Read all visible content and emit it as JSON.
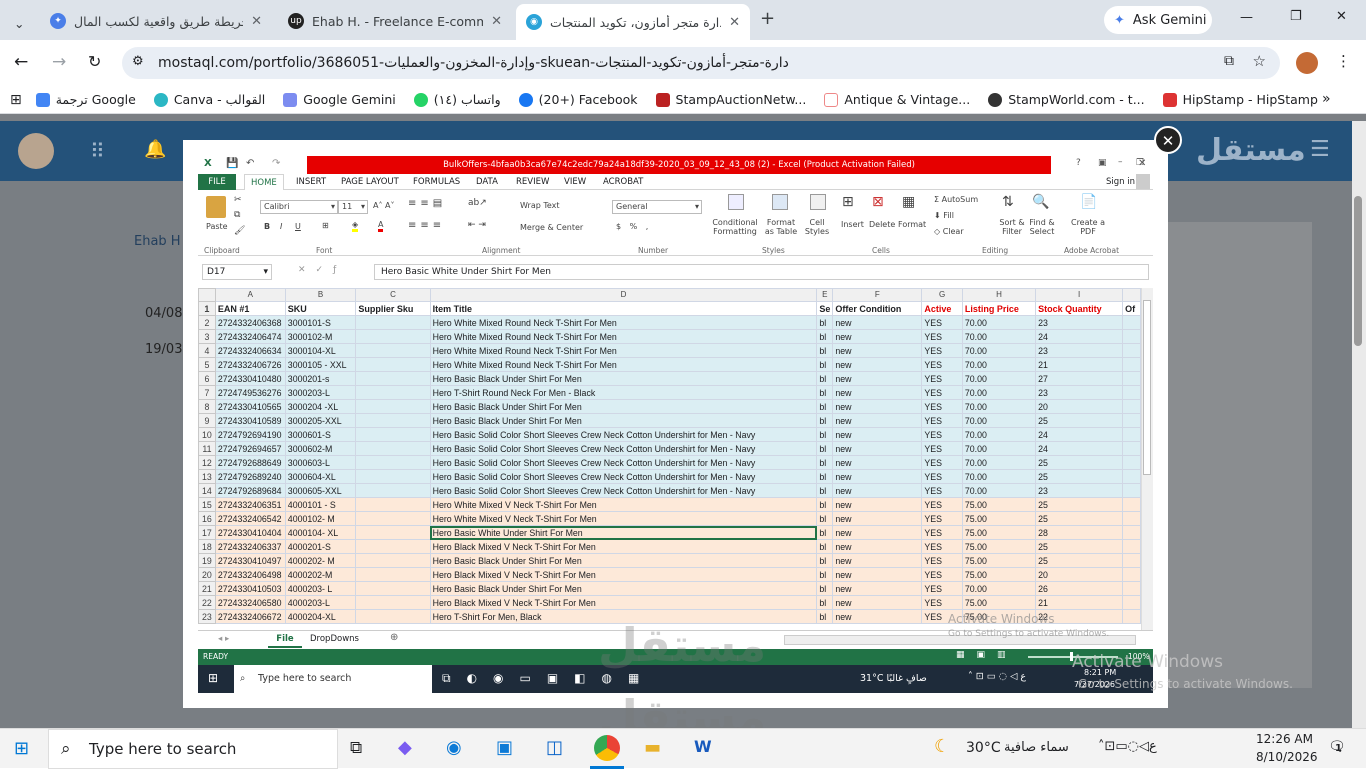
{
  "browser": {
    "tabs": [
      {
        "title": "خريطة طريق واقعية لكسب المال",
        "icon": "gemini-icon"
      },
      {
        "title": "Ehab H. - Freelance E-commerc",
        "icon": "upwork-icon"
      },
      {
        "title": "دارة متجر أمازون، تكويد المنتجات",
        "icon": "mostaql-icon"
      }
    ],
    "ask_gemini": "Ask Gemini",
    "url": "mostaql.com/portfolio/3686051-وإدارة-المخزون-والعمليات-skuean-دارة-متجر-أمازون-تكويد-المنتجات",
    "bookmarks": [
      "ترجمة Google",
      "Canva - القوالب",
      "Google Gemini",
      "(١٤) واتساب",
      "(20+) Facebook",
      "StampAuctionNetw...",
      "Antique & Vintage...",
      "StampWorld.com - t...",
      "HipStamp - HipStamp"
    ]
  },
  "site": {
    "logo": "مستقل",
    "side_name": "Ehab H",
    "dates": [
      "04/08",
      "19/03"
    ]
  },
  "excel": {
    "title": "BulkOffers-4bfaa0b3ca67e74c2edc79a24a18df39-2020_03_09_12_43_08 (2) -  Excel (Product Activation Failed)",
    "sign_in": "Sign in",
    "ribbon_tabs": [
      "FILE",
      "HOME",
      "INSERT",
      "PAGE LAYOUT",
      "FORMULAS",
      "DATA",
      "REVIEW",
      "VIEW",
      "ACROBAT"
    ],
    "font_name": "Calibri",
    "font_size": "11",
    "number_format": "General",
    "groups": [
      "Clipboard",
      "Font",
      "Alignment",
      "Number",
      "Styles",
      "Cells",
      "Editing",
      "Adobe Acrobat"
    ],
    "buttons": [
      "Paste",
      "Wrap Text",
      "Merge & Center",
      "Conditional Formatting",
      "Format as Table",
      "Cell Styles",
      "Insert",
      "Delete",
      "Format",
      "AutoSum",
      "Fill",
      "Clear",
      "Sort & Filter",
      "Find & Select",
      "Create a PDF"
    ],
    "name_box": "D17",
    "formula": "Hero Basic White Under Shirt For Men",
    "col_letters": [
      "A",
      "B",
      "C",
      "D",
      "E",
      "F",
      "G",
      "H",
      "I"
    ],
    "headers": [
      "EAN #1",
      "SKU",
      "Supplier Sku",
      "Item Title",
      "Se",
      "Offer Condition",
      "Active",
      "Listing Price",
      "Stock Quantity",
      "Of"
    ],
    "rows": [
      [
        "2724332406368",
        "3000101-S",
        "",
        "Hero White Mixed Round Neck T-Shirt For Men",
        "bl",
        "new",
        "YES",
        "70.00",
        "23"
      ],
      [
        "2724332406474",
        "3000102-M",
        "",
        "Hero White Mixed Round Neck T-Shirt For Men",
        "bl",
        "new",
        "YES",
        "70.00",
        "24"
      ],
      [
        "2724332406634",
        "3000104-XL",
        "",
        "Hero White Mixed Round Neck T-Shirt For Men",
        "bl",
        "new",
        "YES",
        "70.00",
        "23"
      ],
      [
        "2724332406726",
        "3000105 - XXL",
        "",
        "Hero White Mixed Round Neck T-Shirt For Men",
        "bl",
        "new",
        "YES",
        "70.00",
        "21"
      ],
      [
        "2724330410480",
        "3000201-s",
        "",
        "Hero Basic Black Under Shirt For Men",
        "bl",
        "new",
        "YES",
        "70.00",
        "27"
      ],
      [
        "2724749536276",
        "3000203-L",
        "",
        "Hero T-Shirt Round Neck For Men - Black",
        "bl",
        "new",
        "YES",
        "70.00",
        "23"
      ],
      [
        "2724330410565",
        "3000204 -XL",
        "",
        "Hero Basic Black Under Shirt For Men",
        "bl",
        "new",
        "YES",
        "70.00",
        "20"
      ],
      [
        "2724330410589",
        "3000205-XXL",
        "",
        "Hero Basic Black Under Shirt For Men",
        "bl",
        "new",
        "YES",
        "70.00",
        "25"
      ],
      [
        "2724792694190",
        "3000601-S",
        "",
        "Hero Basic Solid Color Short Sleeves Crew Neck Cotton Undershirt for Men - Navy",
        "bl",
        "new",
        "YES",
        "70.00",
        "24"
      ],
      [
        "2724792694657",
        "3000602-M",
        "",
        "Hero Basic Solid Color Short Sleeves Crew Neck Cotton Undershirt for Men - Navy",
        "bl",
        "new",
        "YES",
        "70.00",
        "24"
      ],
      [
        "2724792688649",
        "3000603-L",
        "",
        "Hero Basic Solid Color Short Sleeves Crew Neck Cotton Undershirt for Men - Navy",
        "bl",
        "new",
        "YES",
        "70.00",
        "25"
      ],
      [
        "2724792689240",
        "3000604-XL",
        "",
        "Hero Basic Solid Color Short Sleeves Crew Neck Cotton Undershirt for Men - Navy",
        "bl",
        "new",
        "YES",
        "70.00",
        "25"
      ],
      [
        "2724792689684",
        "3000605-XXL",
        "",
        "Hero Basic Solid Color Short Sleeves Crew Neck Cotton Undershirt for Men - Navy",
        "bl",
        "new",
        "YES",
        "70.00",
        "23"
      ],
      [
        "2724332406351",
        "4000101 - S",
        "",
        "Hero White Mixed V Neck T-Shirt For Men",
        "bl",
        "new",
        "YES",
        "75.00",
        "25"
      ],
      [
        "2724332406542",
        "4000102- M",
        "",
        "Hero White Mixed V Neck T-Shirt For Men",
        "bl",
        "new",
        "YES",
        "75.00",
        "25"
      ],
      [
        "2724330410404",
        "4000104- XL",
        "",
        "Hero Basic White Under Shirt For Men",
        "bl",
        "new",
        "YES",
        "75.00",
        "28"
      ],
      [
        "2724332406337",
        "4000201-S",
        "",
        "Hero Black Mixed V Neck T-Shirt For Men",
        "bl",
        "new",
        "YES",
        "75.00",
        "25"
      ],
      [
        "2724330410497",
        "4000202- M",
        "",
        "Hero Basic Black Under Shirt For Men",
        "bl",
        "new",
        "YES",
        "75.00",
        "25"
      ],
      [
        "2724332406498",
        "4000202-M",
        "",
        "Hero Black Mixed V Neck T-Shirt For Men",
        "bl",
        "new",
        "YES",
        "75.00",
        "20"
      ],
      [
        "2724330410503",
        "4000203- L",
        "",
        "Hero Basic Black Under Shirt For Men",
        "bl",
        "new",
        "YES",
        "70.00",
        "26"
      ],
      [
        "2724332406580",
        "4000203-L",
        "",
        "Hero Black Mixed V Neck T-Shirt For Men",
        "bl",
        "new",
        "YES",
        "75.00",
        "21"
      ],
      [
        "2724332406672",
        "4000204-XL",
        "",
        "Hero T-Shirt For Men, Black",
        "bl",
        "new",
        "YES",
        "75.00",
        "22"
      ]
    ],
    "sheet_tabs": [
      "File",
      "DropDowns"
    ],
    "status": "READY",
    "zoom": "100%"
  },
  "inner_taskbar": {
    "search": "Type here to search",
    "weather": "31°C  صافٍ غالبًا",
    "time": "8:21 PM",
    "date": "7/27/2026"
  },
  "watermark": {
    "activate": "Activate Windows",
    "goto": "Go to Settings to activate Windows."
  },
  "taskbar": {
    "search": "Type here to search",
    "weather_temp": "30°C",
    "weather_text": "سماء صافية",
    "time": "12:26 AM",
    "date": "8/10/2026",
    "notif": "1"
  }
}
